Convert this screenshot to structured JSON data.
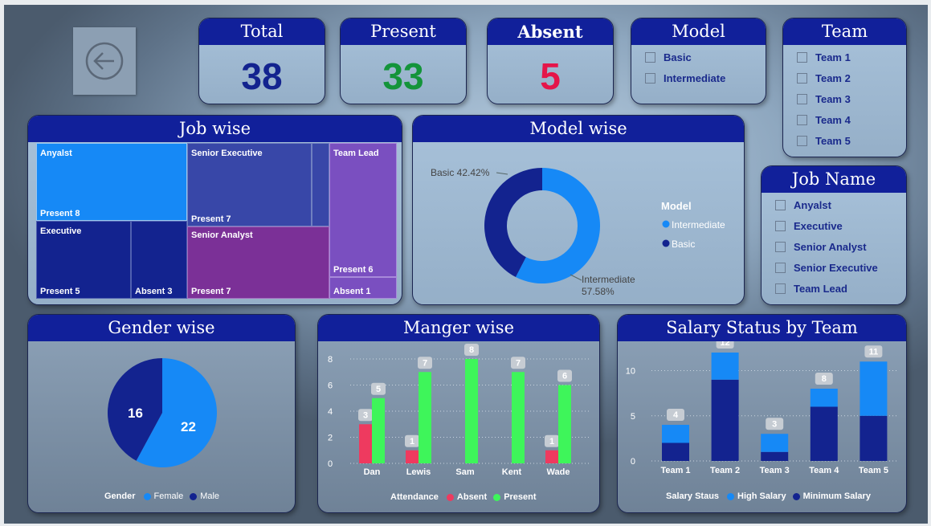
{
  "kpis": {
    "total": {
      "label": "Total",
      "value": "38",
      "color": "#13238f"
    },
    "present": {
      "label": "Present",
      "value": "33",
      "color": "#14943a"
    },
    "absent": {
      "label": "Absent",
      "value": "5",
      "color": "#e5154a"
    }
  },
  "model_slicer": {
    "title": "Model",
    "items": [
      "Basic",
      "Intermediate"
    ]
  },
  "team_slicer": {
    "title": "Team",
    "items": [
      "Team 1",
      "Team 2",
      "Team 3",
      "Team 4",
      "Team 5"
    ]
  },
  "job_slicer": {
    "title": "Job Name",
    "items": [
      "Anyalst",
      "Executive",
      "Senior Analyst",
      "Senior Executive",
      "Team Lead"
    ]
  },
  "job_wise": {
    "title": "Job wise",
    "cells": [
      {
        "name": "Anyalst",
        "sub": "Present 8"
      },
      {
        "name": "Senior Executive",
        "sub": "Present 7"
      },
      {
        "name": "Team Lead",
        "sub": "Present 6"
      },
      {
        "name": "",
        "sub": "Absent 1"
      },
      {
        "name": "Executive",
        "sub": "Present 5"
      },
      {
        "name": "",
        "sub": "Absent 3"
      },
      {
        "name": "Senior Analyst",
        "sub": "Present 7"
      }
    ]
  },
  "model_wise": {
    "title": "Model wise",
    "legend_title": "Model",
    "label_basic": "Basic 42.42%",
    "label_intermediate_1": "Intermediate",
    "label_intermediate_2": "57.58%",
    "legend": [
      "Intermediate",
      "Basic"
    ]
  },
  "gender_wise": {
    "title": "Gender wise",
    "legend_title": "Gender",
    "legend": [
      "Female",
      "Male"
    ],
    "label_male": "16",
    "label_female": "22"
  },
  "manager_wise": {
    "title": "Manger wise",
    "legend_title": "Attendance",
    "legend": [
      "Absent",
      "Present"
    ]
  },
  "salary_team": {
    "title": "Salary Status by Team",
    "legend_title": "Salary Staus",
    "legend": [
      "High Salary",
      "Minimum Salary"
    ]
  },
  "chart_data": [
    {
      "type": "pie",
      "title": "Model wise",
      "categories": [
        "Intermediate",
        "Basic"
      ],
      "values": [
        57.58,
        42.42
      ],
      "colors": [
        "#1689f6",
        "#13238f"
      ]
    },
    {
      "type": "pie",
      "title": "Gender wise",
      "categories": [
        "Female",
        "Male"
      ],
      "values": [
        22,
        16
      ],
      "colors": [
        "#1689f6",
        "#13238f"
      ]
    },
    {
      "type": "bar",
      "title": "Manger wise",
      "categories": [
        "Dan",
        "Lewis",
        "Sam",
        "Kent",
        "Wade"
      ],
      "series": [
        {
          "name": "Absent",
          "values": [
            3,
            1,
            0,
            0,
            1
          ],
          "color": "#ee3a5f"
        },
        {
          "name": "Present",
          "values": [
            5,
            7,
            8,
            7,
            6
          ],
          "color": "#3ef55a"
        }
      ],
      "yticks": [
        "0",
        "2",
        "4",
        "6",
        "8"
      ],
      "ylim": [
        0,
        8
      ]
    },
    {
      "type": "bar",
      "title": "Salary Status by Team",
      "categories": [
        "Team 1",
        "Team 2",
        "Team 3",
        "Team 4",
        "Team 5"
      ],
      "series": [
        {
          "name": "Minimum Salary",
          "values": [
            2,
            9,
            1,
            6,
            5
          ],
          "color": "#13238f"
        },
        {
          "name": "High Salary",
          "values": [
            2,
            3,
            2,
            2,
            6
          ],
          "color": "#1689f6"
        }
      ],
      "totals": [
        4,
        12,
        3,
        8,
        11
      ],
      "yticks": [
        "0",
        "5",
        "10"
      ],
      "ylim": [
        0,
        12
      ]
    }
  ]
}
